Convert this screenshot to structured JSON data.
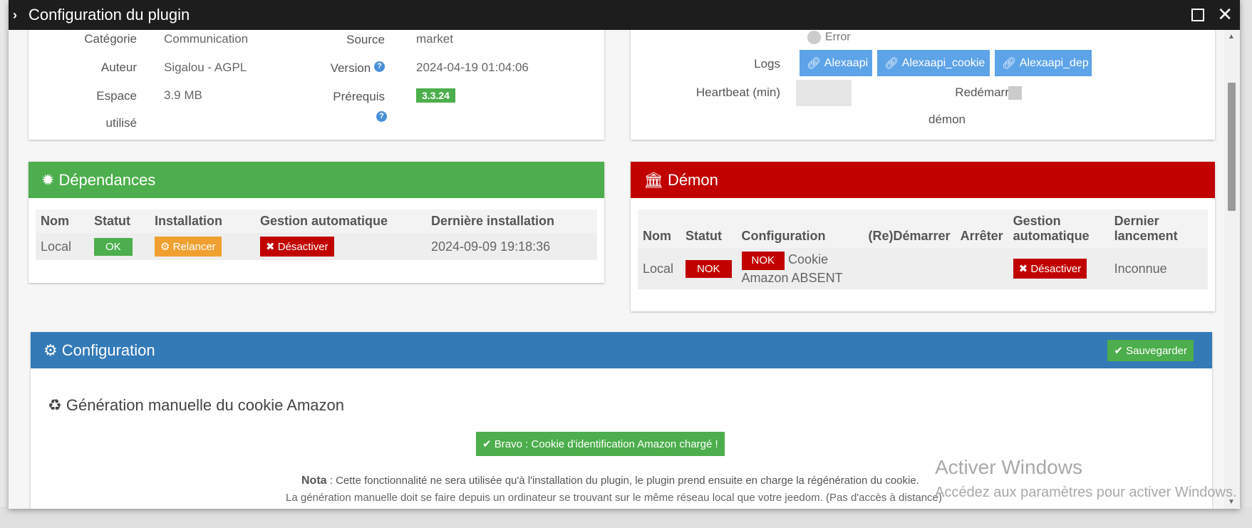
{
  "window": {
    "title": "Configuration du plugin"
  },
  "info": {
    "categorie_label": "Catégorie",
    "categorie_value": "Communication",
    "auteur_label": "Auteur",
    "auteur_value": "Sigalou - AGPL",
    "espace_label": "Espace",
    "espace_label2": "utilisé",
    "espace_value": "3.9 MB",
    "source_label": "Source",
    "source_value": "market",
    "version_label": "Version",
    "version_value": "2024-04-19 01:04:06",
    "prerequis_label": "Prérequis",
    "prerequis_value": "3.3.24",
    "help_glyph": "?"
  },
  "daemon_config": {
    "error_label": "Error",
    "logs_label": "Logs",
    "logs": [
      "Alexaapi",
      "Alexaapi_cookie",
      "Alexaapi_dep"
    ],
    "heartbeat_label": "Heartbeat (min)",
    "restart_label": "Redémarrer",
    "restart_label2": "démon"
  },
  "dependances": {
    "title": "Dépendances",
    "headers": [
      "Nom",
      "Statut",
      "Installation",
      "Gestion automatique",
      "Dernière installation"
    ],
    "row": {
      "nom": "Local",
      "statut": "OK",
      "installation": "Relancer",
      "gestion": "Désactiver",
      "derniere": "2024-09-09 19:18:36"
    }
  },
  "demon": {
    "title": "Démon",
    "headers": [
      "Nom",
      "Statut",
      "Configuration",
      "(Re)Démarrer",
      "Arrêter",
      "Gestion",
      "automatique",
      "Dernier",
      "lancement"
    ],
    "row": {
      "nom": "Local",
      "statut": "NOK",
      "config_badge": "NOK",
      "config_text1": "Cookie",
      "config_text2": "Amazon ABSENT",
      "gestion": "Désactiver",
      "dernier": "Inconnue"
    }
  },
  "configuration": {
    "title": "Configuration",
    "save_label": "Sauvegarder",
    "cookie_title": "Génération manuelle du cookie Amazon",
    "bravo": "Bravo : Cookie d'identification Amazon chargé !",
    "nota_label": "Nota",
    "nota_text": " : Cette fonctionnalité ne sera utilisée qu'à l'installation du plugin, le plugin prend ensuite en charge la régénération du cookie.",
    "nota_line2": "La génération manuelle doit se faire depuis un ordinateur se trouvant sur le même réseau local que votre jeedom. (Pas d'accès à distance)"
  },
  "watermark": {
    "line1": "Activer Windows",
    "line2": "Accédez aux paramètres pour activer Windows."
  },
  "colors": {
    "green": "#4cae4c",
    "red": "#c10000",
    "blue": "#337ab7",
    "orange": "#f0a030",
    "log_blue": "#5da3e8"
  }
}
